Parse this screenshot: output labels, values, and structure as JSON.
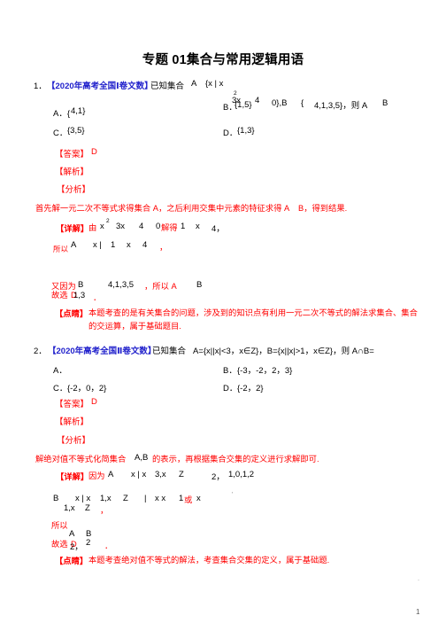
{
  "document": {
    "title": "专题 01集合与常用逻辑用语",
    "page_number": "1"
  },
  "colors": {
    "tag_blue": "#2222cc",
    "answer_red": "#ff0000",
    "body_black": "#000000"
  },
  "problems": [
    {
      "number": "1．",
      "source_tag": "【2020年高考全国Ⅰ卷文数】",
      "stem_lead": "已知集合",
      "stem_set_a": "A",
      "stem_brace_open": "{x | x",
      "stem_exponent": "2",
      "stem_expr": "3x",
      "stem_expr2": "4",
      "stem_expr3": "0},B",
      "stem_set_b": "{",
      "stem_set_b_elems": "4,1,3,5}，则 A",
      "stem_tail": "B",
      "options": [
        {
          "label": "A．{",
          "value": "4,1}"
        },
        {
          "label": "B．",
          "value": "{1,5}"
        },
        {
          "label": "C．",
          "value": "{3,5}"
        },
        {
          "label": "D．",
          "value": "{1,3}"
        }
      ],
      "answer_label": "【答案】",
      "answer_value": "D",
      "jiexi_label": "【解析】",
      "fenxi_label": "【分析】",
      "fenxi_text": "首先解一元二次不等式求得集合 A，之后利用交集中元素的特征求得 A    B，得到结果.",
      "xiangjie_label": "【详解】",
      "xiangjie_lead": "由",
      "xiangjie_x": "x",
      "xiangjie_sup": "2",
      "xiangjie_expr": "3x",
      "xiangjie_expr2": "4",
      "xiangjie_expr3": "0",
      "xiangjie_jiede": "解得",
      "xiangjie_r1": "1",
      "xiangjie_rx": "x",
      "xiangjie_r2": "4，",
      "suoyi_label": "所以",
      "suoyi_a": "A",
      "suoyi_set": "x |",
      "suoyi_l": "1",
      "suoyi_x": "x",
      "suoyi_r": "4",
      "suoyi_comma": "，",
      "youyinwei_label": "又因为",
      "youyinwei_b": "B",
      "youyinwei_set": "4,1,3,5",
      "youyinwei_tail": "，所以 A",
      "youyinwei_tail2": "B",
      "guxuan_label": "故选",
      "guxuan_value": "D",
      "guxuan_overlap": "1,3",
      "guxuan_period": "．",
      "dianjing_label": "【点睛】",
      "dianjing_text": "本题考查的是有关集合的问题，涉及到的知识点有利用一元二次不等式的解法求集合、集合的交运算，属于基础题目."
    },
    {
      "number": "2．",
      "source_tag": "【2020年高考全国Ⅱ卷文数】",
      "stem_lead": "已知集合",
      "stem_body": "A={x||x|<3，x∈Z}，B={x||x|>1，x∈Z}，则 A∩B=",
      "options": [
        {
          "label": "A．",
          "value": ""
        },
        {
          "label": "B．",
          "value": "{-3，-2，2，3}"
        },
        {
          "label": "C．",
          "value": "{-2，0，2}"
        },
        {
          "label": "D．",
          "value": "{-2，2}"
        }
      ],
      "answer_label": "【答案】",
      "answer_value": "D",
      "jiexi_label": "【解析】",
      "fenxi_label": "【分析】",
      "fenxi_text_1": "解绝对值不等式化简集合",
      "fenxi_text_mid": "A,B",
      "fenxi_text_2": "的表示，再根据集合交集的定义进行求解即可.",
      "xiangjie_label": "【详解】",
      "xiangjie_lead": "因为",
      "xiangjie_a": "A",
      "xiangjie_abs": "x | x",
      "xiangjie_lt": "3,x",
      "xiangjie_z": "Z",
      "xiangjie_set": "2，",
      "xiangjie_set2": "1,0,1,2",
      "line_b": "B",
      "line_b_abs": "x | x",
      "line_b_gt": "1,x",
      "line_b_z": "Z",
      "line_b_bar": "|",
      "line_b_xx": "x x",
      "line_b_one": "1",
      "line_b_or": "或",
      "line_b_x": "x",
      "line_b_wrap1": "1,x",
      "line_b_wrap2": "Z",
      "line_b_comma": "，",
      "suoyi_label": "所以",
      "suoyi_a": "A",
      "suoyi_b": "B",
      "guxuan_label": "故选",
      "guxuan_value": "D",
      "guxuan_overlap1": "2，",
      "guxuan_overlap2": "2",
      "guxuan_period": "．",
      "dianjing_label": "【点睛】",
      "dianjing_text": "本题考查绝对值不等式的解法，考查集合交集的定义，属于基础题."
    }
  ]
}
